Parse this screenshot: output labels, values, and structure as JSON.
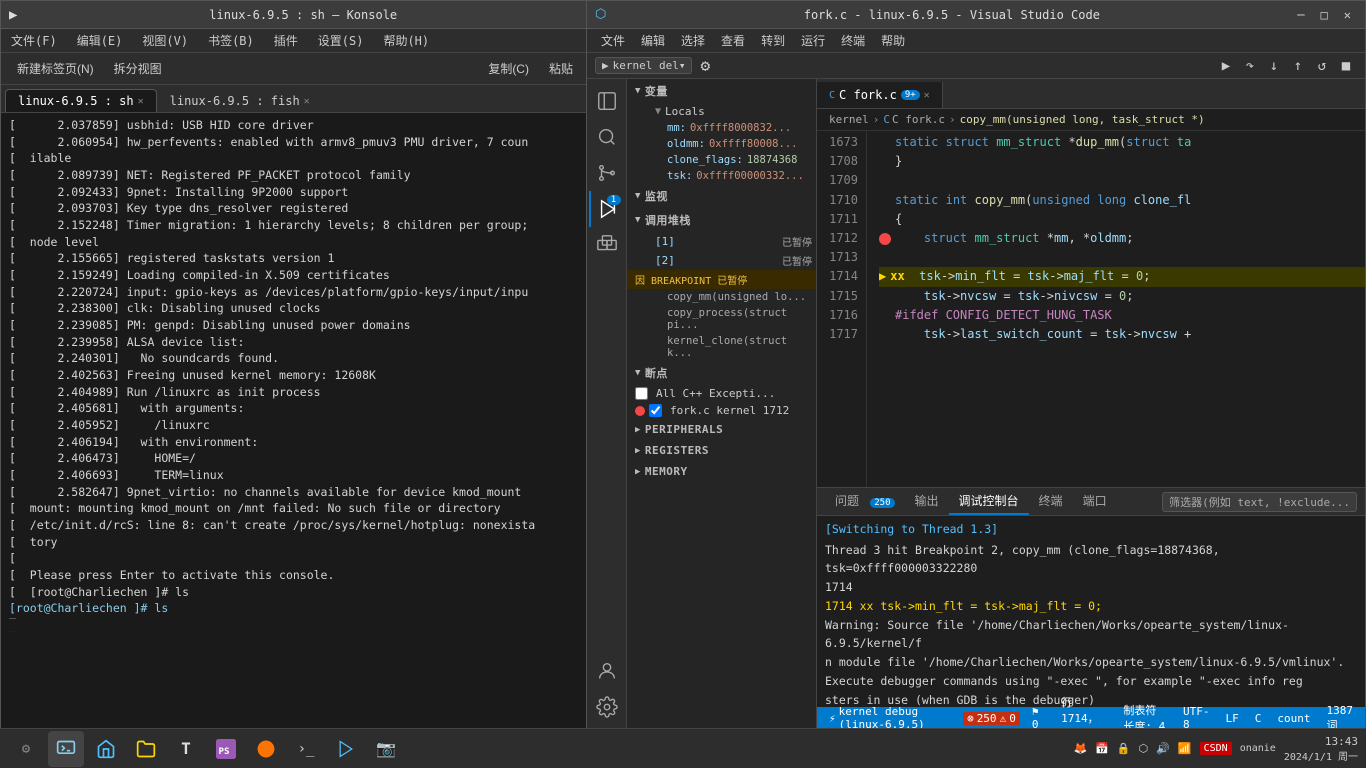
{
  "konsole": {
    "title": "linux-6.9.5 : sh — Konsole",
    "menu": [
      "文件(F)",
      "编辑(E)",
      "视图(V)",
      "书签(B)",
      "插件",
      "设置(S)",
      "帮助(H)"
    ],
    "toolbar": {
      "new_tab": "新建标签页(N)",
      "split_view": "拆分视图",
      "copy": "复制(C)",
      "paste": "粘贴"
    },
    "tabs": [
      {
        "label": "linux-6.9.5 : sh",
        "active": true
      },
      {
        "label": "linux-6.9.5 : fish",
        "active": false
      }
    ],
    "lines": [
      "    2.037859] usbhid: USB HID core driver",
      "    2.060954] hw_perfevents: enabled with armv8_pmuv3 PMU driver, 7 coun",
      "ilable",
      "    2.089739] NET: Registered PF_PACKET protocol family",
      "    2.092433] 9pnet: Installing 9P2000 support",
      "    2.093703] Key type dns_resolver registered",
      "    2.152248] Timer migration: 1 hierarchy levels; 8 children per group;",
      "node level",
      "    2.155665] registered taskstats version 1",
      "    2.159249] Loading compiled-in X.509 certificates",
      "    2.220724] input: gpio-keys as /devices/platform/gpio-keys/input/inpu",
      "    2.238300] clk: Disabling unused clocks",
      "    2.239085] PM: genpd: Disabling unused power domains",
      "    2.239958] ALSA device list:",
      "    2.240301]   No soundcards found.",
      "    2.402563] Freeing unused kernel memory: 12608K",
      "    2.404989] Run /linuxrc as init process",
      "    2.405681]   with arguments:",
      "    2.405952]     /linuxrc",
      "    2.406194]   with environment:",
      "    2.406473]     HOME=/",
      "    2.406693]     TERM=linux",
      "    2.582647] 9pnet_virtio: no channels available for device kmod_mount",
      "mount: mounting kmod_mount on /mnt failed: No such file or directory",
      "/etc/init.d/rcS: line 8: can't create /proc/sys/kernel/hotplug: nonexista",
      "tory",
      "",
      "Please press Enter to activate this console.",
      "[root@Charliechen ]# ls"
    ]
  },
  "vscode": {
    "titlebar": {
      "title": "fork.c - linux-6.9.5 - Visual Studio Code"
    },
    "menu": [
      "文件",
      "编辑",
      "选择",
      "查看",
      "转到",
      "运行",
      "终端",
      "帮助"
    ],
    "debug_toolbar": {
      "kernel_debug": "kernel del▾",
      "settings_icon": "⚙"
    },
    "tabs": [
      {
        "label": "C fork.c",
        "badge": "9+",
        "active": true
      }
    ],
    "breadcrumb": [
      "kernel",
      "C fork.c",
      "copy_mm(unsigned long, task_struct *)"
    ],
    "sidebar": {
      "sections": {
        "variables": {
          "title": "变量",
          "locals": {
            "title": "Locals",
            "items": [
              {
                "name": "mm:",
                "value": "0xffff8000832..."
              },
              {
                "name": "oldmm:",
                "value": "0xffff80008..."
              },
              {
                "name": "clone_flags:",
                "value": "18874368"
              },
              {
                "name": "tsk:",
                "value": "0xffff00000332..."
              }
            ]
          }
        },
        "watch": {
          "title": "监视"
        },
        "call_stack": {
          "title": "调用堆栈",
          "frames": [
            {
              "id": "[1]",
              "status": "已暂停"
            },
            {
              "id": "[2]",
              "status": "已暂停"
            },
            {
              "breakpoint": "因 BREAKPOINT 已暂停"
            },
            {
              "fn1": "copy_mm(unsigned lo..."
            },
            {
              "fn2": "copy_process(struct pi..."
            },
            {
              "fn3": "kernel_clone(struct k..."
            }
          ]
        },
        "breakpoints": {
          "title": "断点",
          "items": [
            {
              "label": "All C++ Excepti...",
              "checked": false
            },
            {
              "label": "fork.c  kernel  1712",
              "checked": true,
              "color": "red"
            }
          ]
        },
        "peripherals": {
          "title": "PERIPHERALS"
        },
        "registers": {
          "title": "REGISTERS"
        },
        "memory": {
          "title": "MEMORY"
        }
      }
    },
    "editor": {
      "lines": [
        {
          "num": "1673",
          "code": "static struct mm_struct *dup_mm(struct ta"
        },
        {
          "num": "1708",
          "code": "}"
        },
        {
          "num": "1709",
          "code": ""
        },
        {
          "num": "1710",
          "code": "static int copy_mm(unsigned long clone_fl"
        },
        {
          "num": "1711",
          "code": "{"
        },
        {
          "num": "1712",
          "code": "    struct mm_struct *mm, *oldmm;",
          "breakpoint": true
        },
        {
          "num": "1713",
          "code": ""
        },
        {
          "num": "1714",
          "code": "    tsk->min_flt = tsk->maj_flt = 0;",
          "arrow": true
        },
        {
          "num": "1715",
          "code": "    tsk->nvcsw = tsk->nivcsw = 0;"
        },
        {
          "num": "1716",
          "code": "#ifdef CONFIG_DETECT_HUNG_TASK"
        },
        {
          "num": "1717",
          "code": "    tsk->last_switch_count = tsk->nvcsw +"
        }
      ]
    },
    "panel": {
      "tabs": [
        "问题",
        "输出",
        "调试控制台",
        "终端",
        "端口"
      ],
      "problem_count": "250",
      "filter_placeholder": "筛选器(例如 text, !exclude...",
      "debug_output": [
        "[Switching to Thread 1.3]",
        "",
        "Thread 3 hit Breakpoint 2, copy_mm (clone_flags=18874368, tsk=0xffff000003322280",
        "1714",
        "1714  xx  tsk->min_flt = tsk->maj_flt = 0;",
        "Warning: Source file '/home/Charliechen/Works/opearte_system/linux-6.9.5/kernel/f",
        "n module file '/home/Charliechen/Works/opearte_system/linux-6.9.5/vmlinux'.",
        "Execute debugger commands using \"-exec <command>\", for example \"-exec info reg",
        "sters in use (when GDB is the debugger)"
      ]
    },
    "statusbar": {
      "debug_icon": "⚡",
      "errors": "250",
      "warnings": "0",
      "git": "⚑ 0",
      "debug_name": "kernel debug (linux-6.9.5)",
      "position": "行 1714，列 1",
      "indent": "制表符长度: 4",
      "encoding": "UTF-8",
      "line_endings": "LF",
      "language": "C",
      "count": "count",
      "word_count": "1387 词"
    }
  },
  "taskbar": {
    "icons": [
      "▶",
      "🖥",
      "📦",
      "📁",
      "T",
      "🦊",
      ">_",
      "💻",
      "📷"
    ],
    "system_tray": "🔊 🔋 📶",
    "time": "13:43",
    "date": "2024/1/1 周一"
  }
}
